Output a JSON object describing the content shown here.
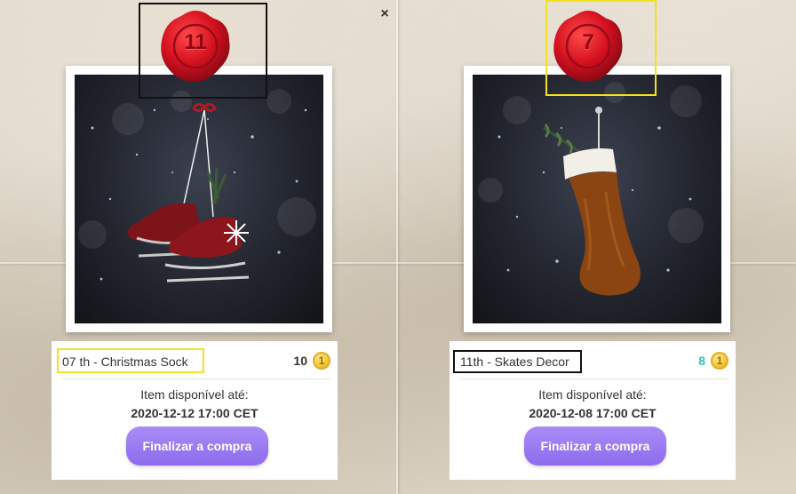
{
  "colors": {
    "button_bg": "#9b7bf2",
    "price_teal": "#2ec4b6",
    "seal_red": "#d4101f",
    "highlight_yellow": "#f3e21b",
    "highlight_black": "#111111"
  },
  "close_label": "×",
  "cards": [
    {
      "seal_number": "11",
      "image_subject": "hanging-red-ice-skates",
      "title": "07 th - Christmas Sock",
      "price": "10",
      "currency_icon": "coin-icon",
      "coin_symbol": "1",
      "available_label": "Item disponível até:",
      "available_date": "2020-12-12 17:00 CET",
      "button_label": "Finalizar a compra"
    },
    {
      "seal_number": "7",
      "image_subject": "brown-christmas-stocking",
      "title": "11th - Skates Decor",
      "price": "8",
      "currency_icon": "coin-icon",
      "coin_symbol": "1",
      "available_label": "Item disponível até:",
      "available_date": "2020-12-08 17:00 CET",
      "button_label": "Finalizar a compra"
    }
  ]
}
